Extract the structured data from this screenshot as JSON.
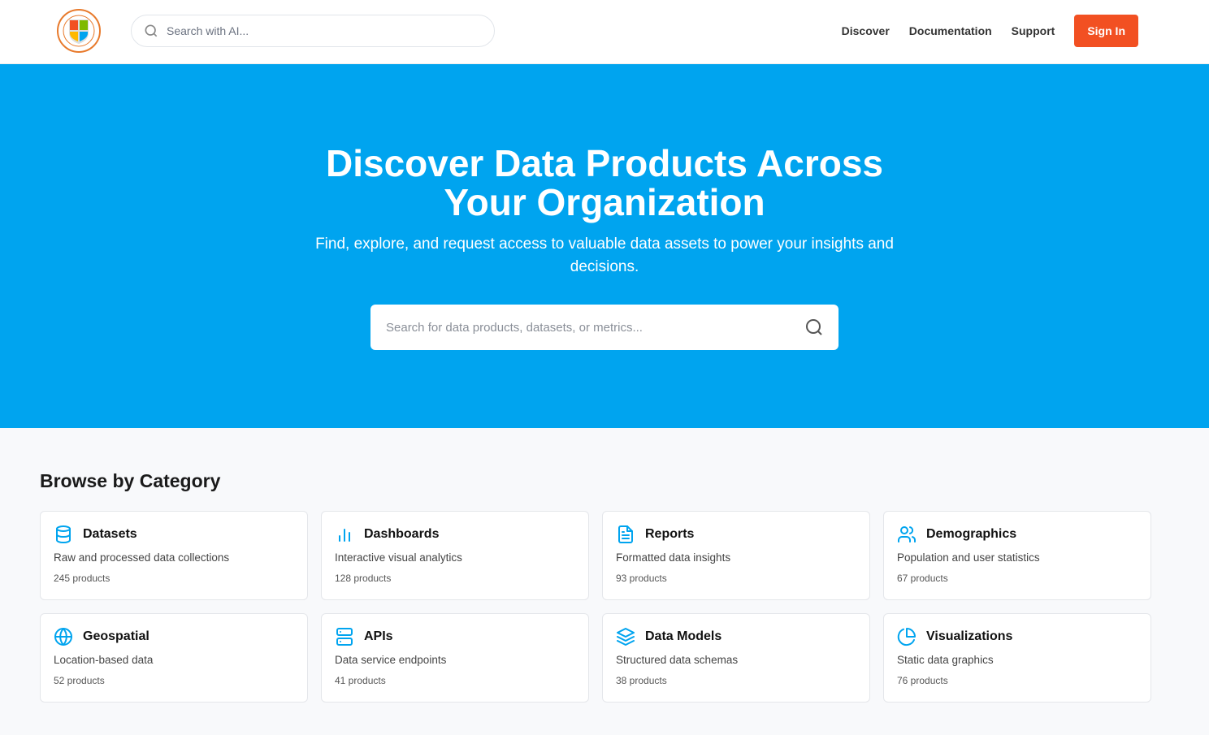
{
  "header": {
    "logo_text": "UNIVERSITY OF CONTOSO",
    "search_placeholder": "Search with AI...",
    "nav": [
      "Discover",
      "Documentation",
      "Support"
    ],
    "sign_in": "Sign In"
  },
  "hero": {
    "title_line1": "Discover Data Products Across",
    "title_line2": "Your Organization",
    "subtitle": "Find, explore, and request access to valuable data assets to power your insights and decisions.",
    "search_placeholder": "Search for data products, datasets, or metrics..."
  },
  "colors": {
    "hero": "#00a4ef",
    "accent": "#f25022",
    "icon": "#00a4ef"
  },
  "browse": {
    "title": "Browse by Category",
    "categories": [
      {
        "icon": "database-icon",
        "name": "Datasets",
        "desc": "Raw and processed data collections",
        "count": "245 products"
      },
      {
        "icon": "bar-chart-icon",
        "name": "Dashboards",
        "desc": "Interactive visual analytics",
        "count": "128 products"
      },
      {
        "icon": "document-icon",
        "name": "Reports",
        "desc": "Formatted data insights",
        "count": "93 products"
      },
      {
        "icon": "users-icon",
        "name": "Demographics",
        "desc": "Population and user statistics",
        "count": "67 products"
      },
      {
        "icon": "globe-icon",
        "name": "Geospatial",
        "desc": "Location-based data",
        "count": "52 products"
      },
      {
        "icon": "server-icon",
        "name": "APIs",
        "desc": "Data service endpoints",
        "count": "41 products"
      },
      {
        "icon": "layers-icon",
        "name": "Data Models",
        "desc": "Structured data schemas",
        "count": "38 products"
      },
      {
        "icon": "pie-chart-icon",
        "name": "Visualizations",
        "desc": "Static data graphics",
        "count": "76 products"
      }
    ]
  }
}
